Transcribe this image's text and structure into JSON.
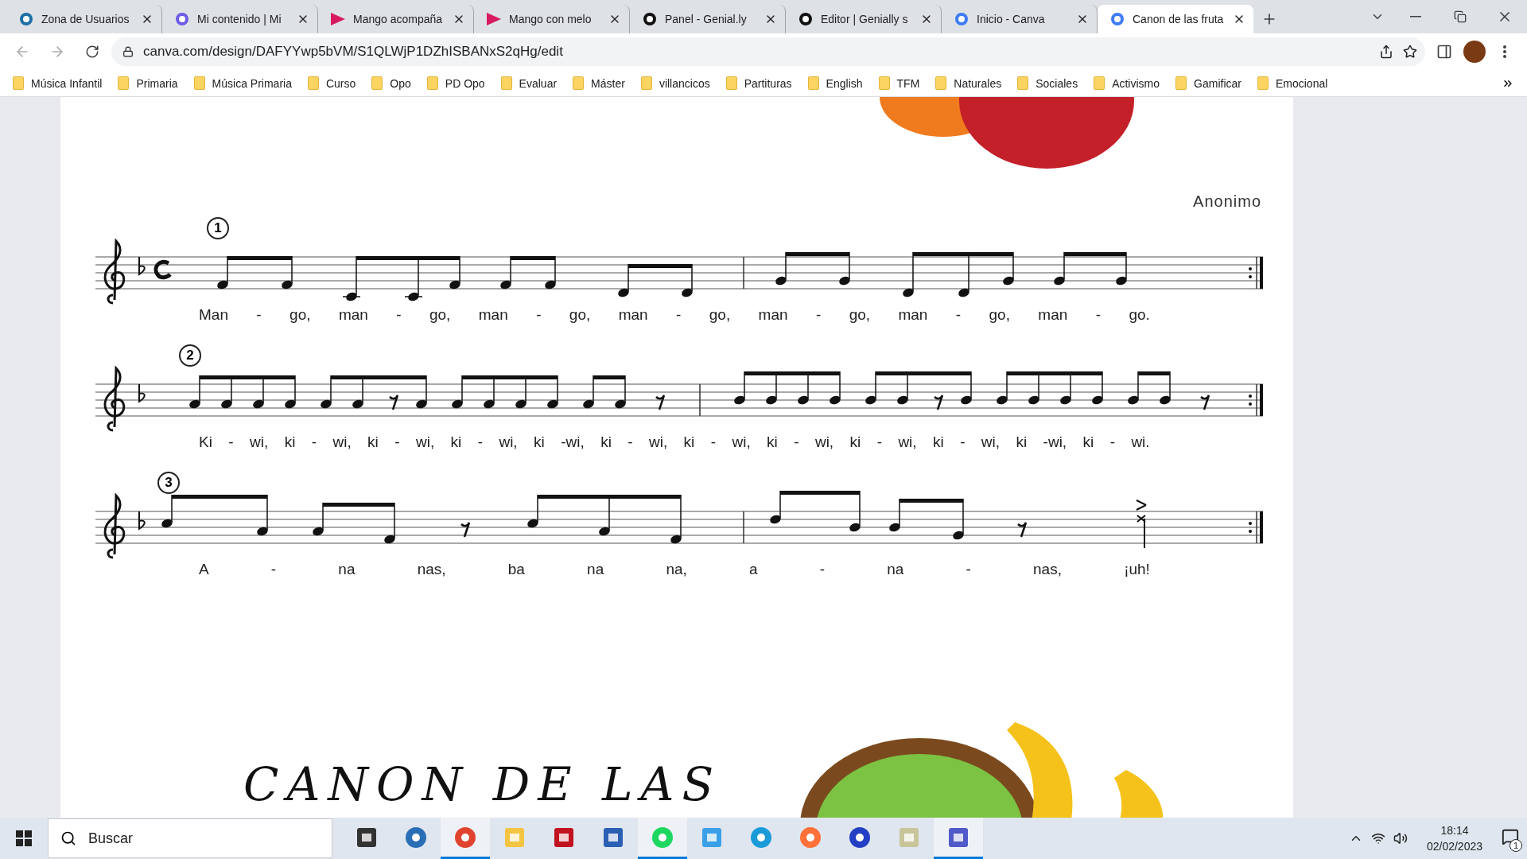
{
  "tabs": [
    {
      "title": "Zona de Usuarios",
      "kind": "peak",
      "selected": false
    },
    {
      "title": "Mi contenido | Mi",
      "kind": "ring",
      "selected": false
    },
    {
      "title": "Mango acompaña",
      "kind": "play",
      "selected": false
    },
    {
      "title": "Mango con melo",
      "kind": "play",
      "selected": false
    },
    {
      "title": "Panel - Genial.ly",
      "kind": "g",
      "selected": false
    },
    {
      "title": "Editor | Genially s",
      "kind": "g",
      "selected": false
    },
    {
      "title": "Inicio - Canva",
      "kind": "c",
      "selected": false
    },
    {
      "title": "Canon de las fruta",
      "kind": "c",
      "selected": true
    }
  ],
  "address_bar": {
    "url": "canva.com/design/DAFYYwp5bVM/S1QLWjP1DZhISBANxS2qHg/edit"
  },
  "bookmarks": [
    "Música Infantil",
    "Primaria",
    "Música Primaria",
    "Curso",
    "Opo",
    "PD Opo",
    "Evaluar",
    "Máster",
    "villancicos",
    "Partituras",
    "English",
    "TFM",
    "Naturales",
    "Sociales",
    "Activismo",
    "Gamificar",
    "Emocional"
  ],
  "design": {
    "composer": "Anonimo",
    "staves": [
      {
        "number": "1",
        "lyrics": [
          "Man",
          "-",
          "go,",
          "man",
          "-",
          "go,",
          "man",
          "-",
          "go,",
          "man",
          "-",
          "go,",
          "man",
          "-",
          "go,",
          "man",
          "-",
          "go,",
          "man",
          "-",
          "go."
        ]
      },
      {
        "number": "2",
        "lyrics": [
          "Ki",
          "-",
          "wi,",
          "ki",
          "-",
          "wi,",
          "ki",
          "-",
          "wi,",
          "ki",
          "-",
          "wi,",
          "ki",
          "-wi,",
          "ki",
          "-",
          "wi,",
          "ki",
          "-",
          "wi,",
          "ki",
          "-",
          "wi,",
          "ki",
          "-",
          "wi,",
          "ki",
          "-",
          "wi,",
          "ki",
          "-wi,",
          "ki",
          "-",
          "wi."
        ]
      },
      {
        "number": "3",
        "lyrics": [
          "A",
          "-",
          "na",
          "nas,",
          "ba",
          "na",
          "na,",
          "a",
          "-",
          "na",
          "-",
          "nas,",
          "¡uh!"
        ]
      }
    ],
    "title": "CANON DE LAS"
  },
  "taskbar": {
    "search_placeholder": "Buscar",
    "apps": [
      {
        "kind": "taskview",
        "active": false
      },
      {
        "kind": "mu",
        "active": false
      },
      {
        "kind": "chrome",
        "active": true
      },
      {
        "kind": "folder",
        "active": false
      },
      {
        "kind": "pdf",
        "active": false
      },
      {
        "kind": "word",
        "active": false
      },
      {
        "kind": "spotify",
        "active": true
      },
      {
        "kind": "video",
        "active": false
      },
      {
        "kind": "edge",
        "active": false
      },
      {
        "kind": "firefox",
        "active": false
      },
      {
        "kind": "headphones",
        "active": false
      },
      {
        "kind": "tool",
        "active": false
      },
      {
        "kind": "teams",
        "active": true
      }
    ],
    "time": "18:14",
    "date": "02/02/2023",
    "notifications": "1"
  }
}
